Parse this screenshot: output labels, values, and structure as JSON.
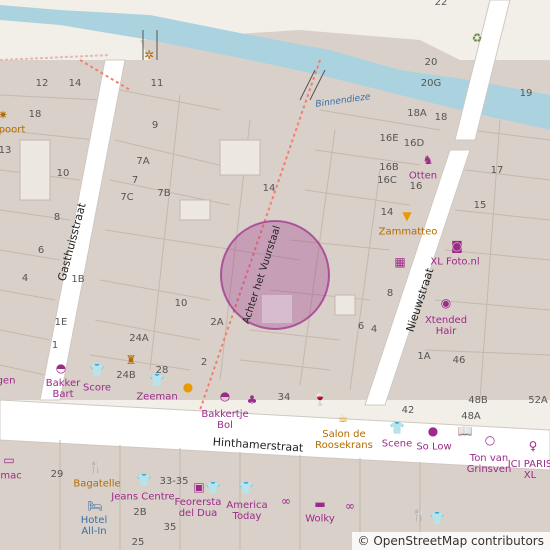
{
  "map": {
    "attribution": "© OpenStreetMap contributors",
    "colors": {
      "land": "#f2efe9",
      "building": "#d9d0c9",
      "road": "#ffffff",
      "water": "#aad3df",
      "marker": "#9c2a8a"
    },
    "streets": {
      "gasthuisstraat": "Gasthuisstraat",
      "achter_het_vuurstaal": "Achter het Vuurstaal",
      "nieuwstraat": "Nieuwstraat",
      "hinthamerstraat": "Hinthamerstraat"
    },
    "waterway": "Binnendieze",
    "house_numbers": [
      "22",
      "20",
      "20G",
      "18A",
      "18",
      "16E",
      "16D",
      "16B",
      "16C",
      "16",
      "14",
      "15",
      "17",
      "19",
      "12",
      "14",
      "11",
      "9",
      "7A",
      "7",
      "7B",
      "7C",
      "14",
      "10",
      "8",
      "6",
      "4",
      "18",
      "13",
      "1B",
      "1E",
      "1",
      "10",
      "2A",
      "24A",
      "24B",
      "28",
      "2",
      "8",
      "6",
      "4",
      "1A",
      "46",
      "48B",
      "48A",
      "42",
      "52A",
      "29",
      "33-35",
      "2B",
      "25",
      "35",
      "34"
    ],
    "pois": {
      "otten": "Otten",
      "zammatteo": "Zammatteo",
      "xl_foto": "XL Foto.nl",
      "xtended_hair": "Xtended Hair",
      "bakker_bart": "Bakker Bart",
      "score": "Score",
      "zeeman": "Zeeman",
      "bakkertje_bol": "Bakkertje Bol",
      "salon": "Salon de Roosekrans",
      "scene": "Scene",
      "so_low": "So Low",
      "ton_van_grinsven": "Ton van Grinsven",
      "ici_paris": "ICI PARIS XL",
      "bagatelle": "Bagatelle",
      "jeans_centre": "Jeans Centre",
      "feorersta": "Feorersta del Dua",
      "america_today": "America Today",
      "wolky": "Wolky",
      "hotel_all_in": "Hotel All-In",
      "poort": "poort",
      "gen": "gen",
      "amac": "amac"
    }
  }
}
